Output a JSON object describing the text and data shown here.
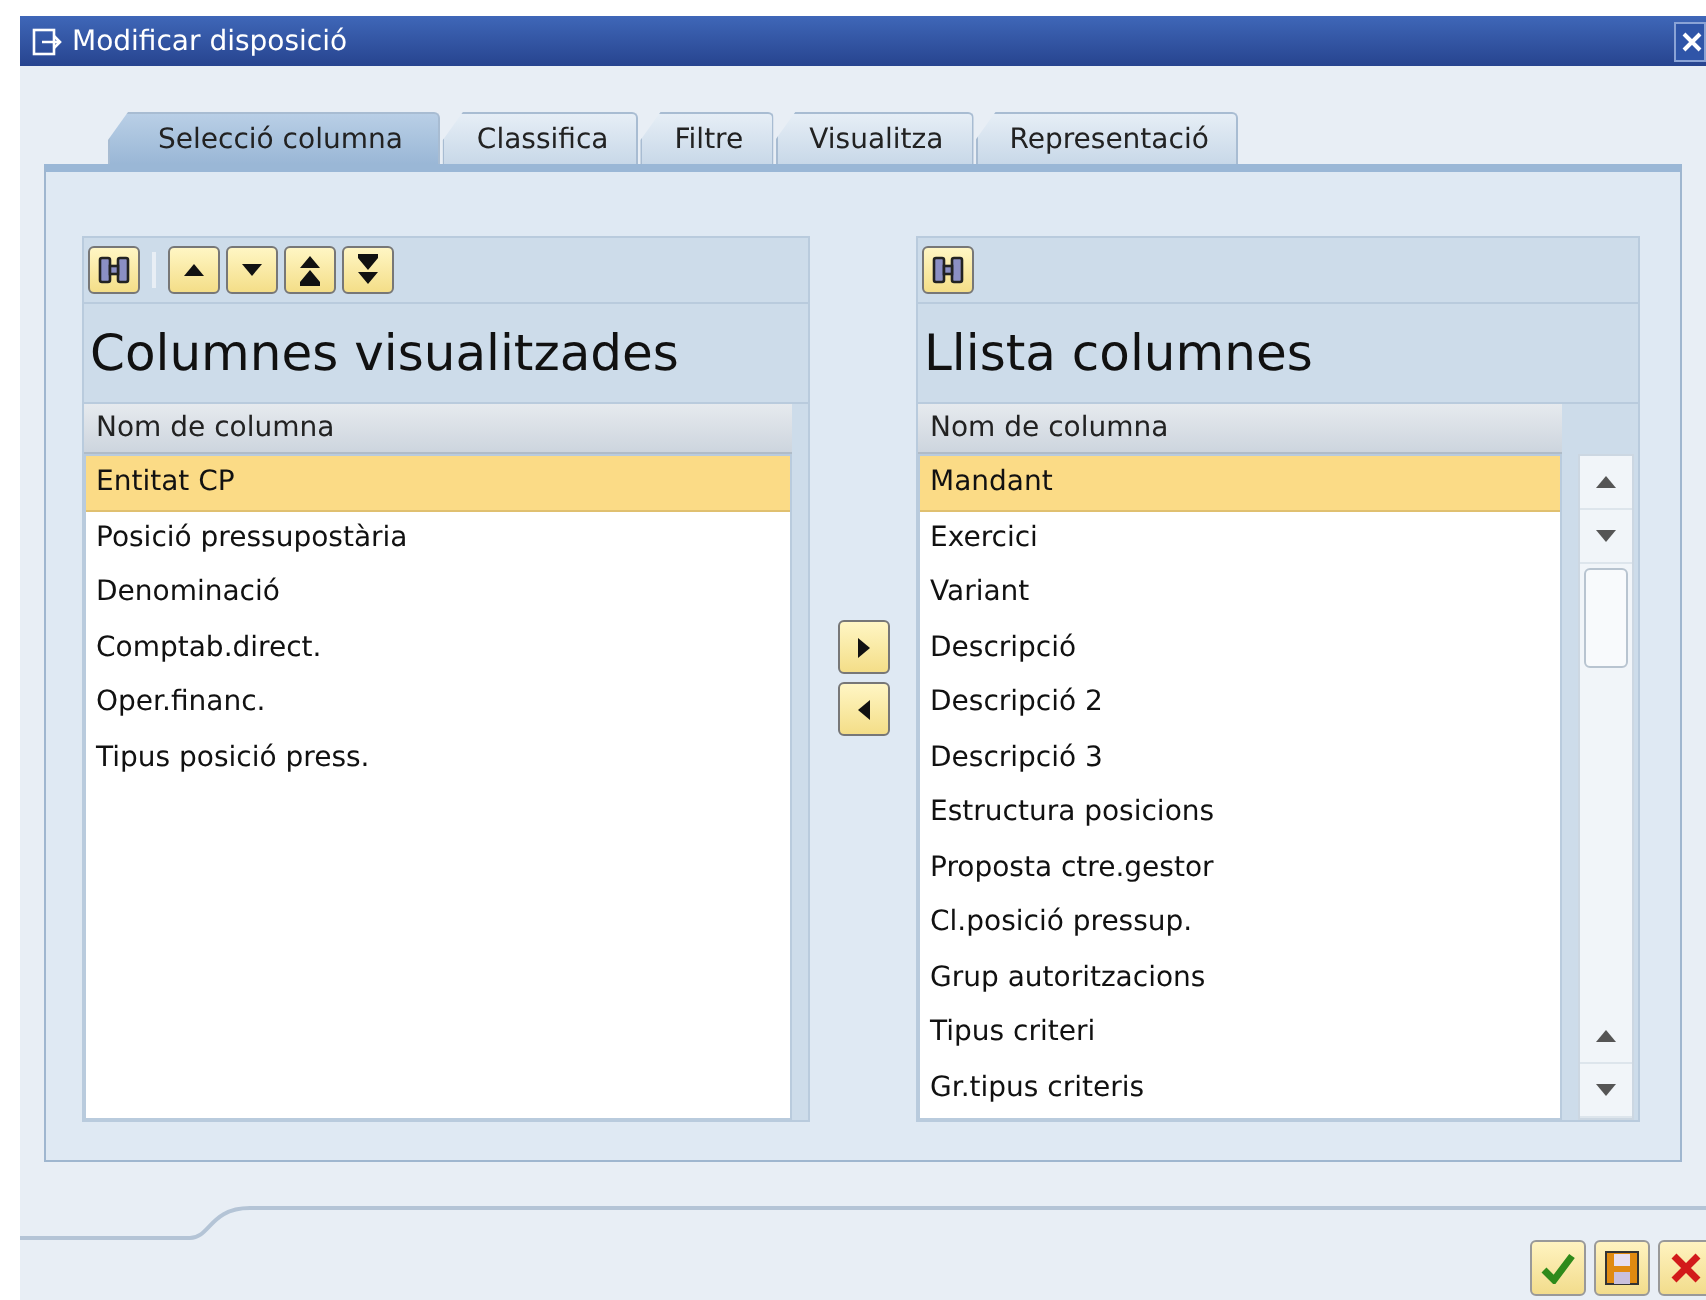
{
  "window": {
    "title": "Modificar disposició"
  },
  "tabs": [
    {
      "label": "Selecció columna",
      "selected": true
    },
    {
      "label": "Classifica",
      "selected": false
    },
    {
      "label": "Filtre",
      "selected": false
    },
    {
      "label": "Visualitza",
      "selected": false
    },
    {
      "label": "Representació",
      "selected": false
    }
  ],
  "displayed_columns": {
    "title": "Columnes visualitzades",
    "header": "Nom de columna",
    "rows": [
      {
        "label": "Entitat CP",
        "selected": true
      },
      {
        "label": "Posició pressupostària",
        "selected": false
      },
      {
        "label": "Denominació",
        "selected": false
      },
      {
        "label": "Comptab.direct.",
        "selected": false
      },
      {
        "label": "Oper.financ.",
        "selected": false
      },
      {
        "label": "Tipus posició press.",
        "selected": false
      }
    ]
  },
  "column_list": {
    "title": "Llista columnes",
    "header": "Nom de columna",
    "rows": [
      {
        "label": "Mandant",
        "selected": true
      },
      {
        "label": "Exercici",
        "selected": false
      },
      {
        "label": "Variant",
        "selected": false
      },
      {
        "label": "Descripció",
        "selected": false
      },
      {
        "label": "Descripció 2",
        "selected": false
      },
      {
        "label": "Descripció 3",
        "selected": false
      },
      {
        "label": "Estructura posicions",
        "selected": false
      },
      {
        "label": "Proposta ctre.gestor",
        "selected": false
      },
      {
        "label": "Cl.posició pressup.",
        "selected": false
      },
      {
        "label": "Grup autoritzacions",
        "selected": false
      },
      {
        "label": "Tipus criteri",
        "selected": false
      },
      {
        "label": "Gr.tipus criteris",
        "selected": false
      }
    ]
  }
}
